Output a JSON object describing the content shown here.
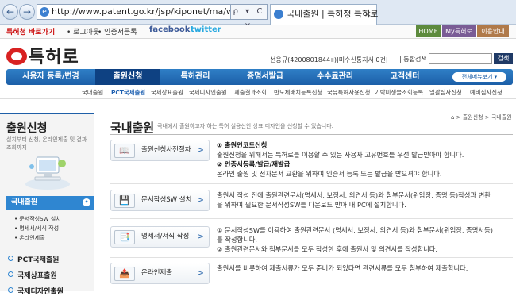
{
  "browser": {
    "url": "http://www.patent.go.kr/jsp/kiponet/ma/websolution/OnlineInd",
    "addr_tools": "ρ ▾ C ×",
    "tab_title": "국내출원 | 특허청 특허로",
    "tab_close": "×",
    "back": "←",
    "forward": "→"
  },
  "util": {
    "shortcut": "특허청 바로가기",
    "logout": "• 로그아웃",
    "cert": "• 인증서등록",
    "facebook": "facebook",
    "twitter": "twitter",
    "btn_home": "HOME",
    "btn_my": "My특허로",
    "btn_guide": "이용안내"
  },
  "header": {
    "logo_text": "특허로",
    "user": "선웅규(4200801844॥)|미수신통지서 0건|",
    "search_label": "| 통합검색",
    "search_button": "검색"
  },
  "mainnav": {
    "items": [
      "사용자 등록/변경",
      "출원신청",
      "특허관리",
      "증명서발급",
      "수수료관리",
      "고객센터"
    ],
    "full_menu": "전체메뉴보기 ▾"
  },
  "subnav": {
    "items": [
      "국내출원",
      "PCT국제출원",
      "국제상표출원",
      "국제디자인출원",
      "제출결과조회",
      "반도체배치등록신청",
      "국유특허사용신청",
      "기탁미생물조회등록",
      "일괄심사신청",
      "예비심사신청"
    ]
  },
  "sidebar": {
    "title": "출원신청",
    "desc": "설치부터 신청, 온라인제출 및 결과조회까지",
    "active": "국내출원",
    "active_mark": "•",
    "subitems": [
      "• 문서작성SW 설치",
      "• 명세서/서식 작성",
      "• 온라인제출"
    ],
    "menus": [
      "PCT국제출원",
      "국제상표출원",
      "국제디자인출원"
    ]
  },
  "content": {
    "title": "국내출원",
    "subtitle": "국내에서 출원하고자 하는 특허 실용신안 상표 디자인을 신청할 수 있습니다.",
    "breadcrumb": "⌂ > 출원신청 > 국내출원",
    "steps": [
      {
        "label": "출원신청사전절차",
        "icon": "📖",
        "lines": [
          "① 출원인코드신청",
          "출원신청을 위해서는 특허로를 이용할 수 있는 사용자 고유번호를 우선 발급받아야 합니다.",
          "② 인증서등록/발급/재발급",
          "온라인 출원 및 전자문서 교환을 위하여 인증서 등록 또는 발급을 받으셔야 합니다."
        ]
      },
      {
        "label": "문서작성SW 설치",
        "icon": "💾",
        "lines": [
          "출원서 작성 전에 출원관련문서(명세서, 보정서, 의견서 등)와 첨부문서(위임장, 증명 등)작성과 변환",
          "을 위하여 필요한 문서작성SW를 다운로드 받아 내 PC에 설치합니다."
        ]
      },
      {
        "label": "명세서/서식 작성",
        "icon": "📑",
        "lines": [
          "① 문서작성SW를 이용하여 출원관련문서 (명세서, 보정서, 의견서 등)와 첨부문서(위임장, 증명서등)",
          "를 작성합니다.",
          "② 출원관련문서와 첨부문서를 모두 작성한 후에 출원서 및 의견서를 작성합니다."
        ]
      },
      {
        "label": "온라인제출",
        "icon": "📤",
        "lines": [
          "출원서를 비롯하여 제출서류가 모두 준비가 되었다면 관련서류를 모두 첨부하여 제출합니다."
        ]
      }
    ],
    "arrow": ">"
  }
}
